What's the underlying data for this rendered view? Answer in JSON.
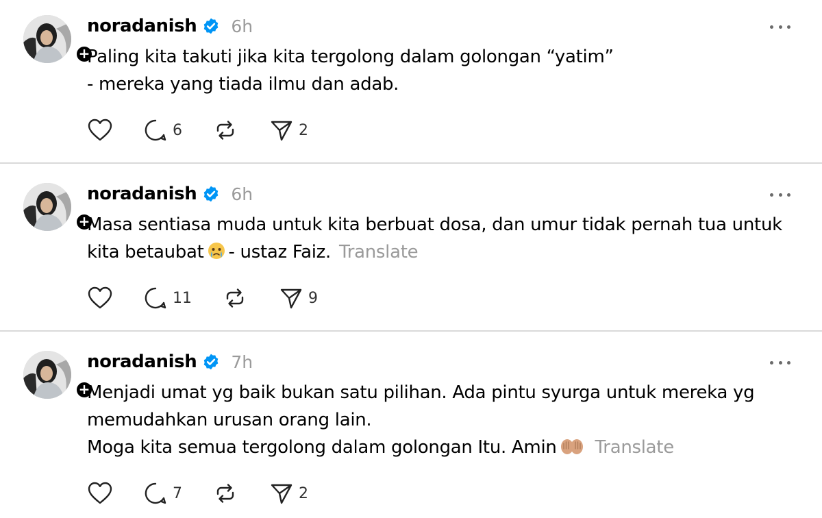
{
  "colors": {
    "text": "#000000",
    "muted": "#9a9a9a",
    "verified": "#0095f6",
    "divider": "#d9d9d9"
  },
  "posts": [
    {
      "username": "noradanish",
      "verified_icon": "verified-badge-icon",
      "time": "6h",
      "lines": [
        "Paling kita takuti jika kita tergolong dalam golongan “yatim”",
        "- mereka yang tiada ilmu dan adab."
      ],
      "translate": "",
      "reply_count": "6",
      "share_count": "2"
    },
    {
      "username": "noradanish",
      "verified_icon": "verified-badge-icon",
      "time": "6h",
      "lines": [
        "Masa sentiasa muda untuk kita berbuat dosa, dan umur tidak pernah tua untuk",
        "kita betaubat"
      ],
      "line_suffix": "- ustaz Faiz.",
      "emoji": "crying-face-emoji",
      "translate": "Translate",
      "reply_count": "11",
      "share_count": "9"
    },
    {
      "username": "noradanish",
      "verified_icon": "verified-badge-icon",
      "time": "7h",
      "lines": [
        "Menjadi umat yg baik bukan satu pilihan. Ada pintu syurga untuk mereka yg",
        "memudahkan urusan orang lain.",
        "Moga kita semua tergolong dalam golongan Itu. Amin"
      ],
      "emoji": "praying-hands-emoji",
      "translate": "Translate",
      "reply_count": "7",
      "share_count": "2"
    }
  ]
}
